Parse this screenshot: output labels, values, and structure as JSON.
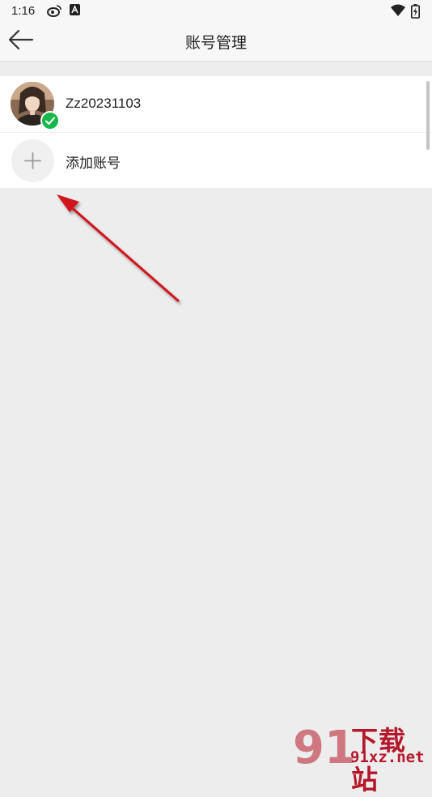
{
  "status_bar": {
    "time": "1:16",
    "icons": [
      "weibo-icon",
      "a-icon",
      "wifi-icon",
      "battery-charging-icon"
    ]
  },
  "header": {
    "title": "账号管理",
    "back_icon": "back-arrow-icon"
  },
  "accounts": [
    {
      "username": "Zz20231103",
      "active": true,
      "avatar_icon": "avatar-photo",
      "badge_icon": "check-icon"
    }
  ],
  "add_account": {
    "label": "添加账号",
    "icon": "plus-icon"
  },
  "annotation": {
    "type": "red-arrow",
    "color": "#d0121b"
  },
  "watermark": {
    "line1": "下载站",
    "line2": "91xz.net",
    "logo": "91"
  },
  "colors": {
    "background": "#ededed",
    "card": "#ffffff",
    "active_badge": "#19b84a",
    "watermark": "#b5182a"
  }
}
